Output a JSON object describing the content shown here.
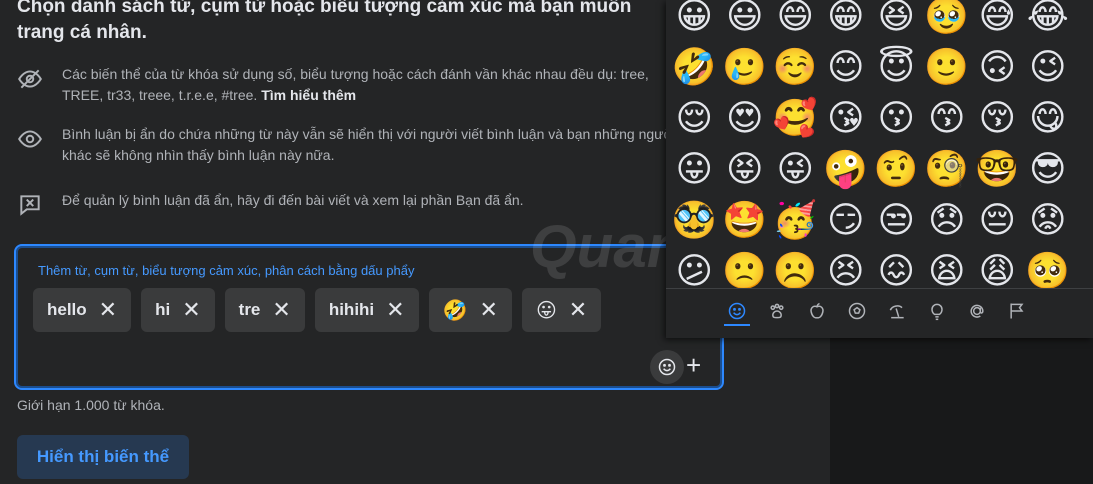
{
  "title": "Chọn danh sách từ, cụm từ hoặc biểu tượng cảm xúc mà bạn muốn trang cá nhân.",
  "info": [
    {
      "icon": "eye-slash-icon",
      "text": "Các biến thể của từ khóa sử dụng số, biểu tượng hoặc cách đánh vần khác nhau đều dụ: tree, TREE, tr33, treee, t.r.e.e, #tree.",
      "link": "Tìm hiểu thêm"
    },
    {
      "icon": "eye-icon",
      "text": "Bình luận bị ẩn do chứa những từ này vẫn sẽ hiển thị với người viết bình luận và bạn những người khác sẽ không nhìn thấy bình luận này nữa."
    },
    {
      "icon": "hidden-comment-icon",
      "text": "Để quản lý bình luận đã ẩn, hãy đi đến bài viết và xem lại phần Bạn đã ẩn."
    }
  ],
  "editor": {
    "placeholder": "Thêm từ, cụm từ, biểu tượng cảm xúc, phân cách bằng dấu phẩy",
    "chips": [
      "hello",
      "hi",
      "tre",
      "hihihi",
      "🤣",
      "😛"
    ],
    "remove_glyph": "✕",
    "plus": "+"
  },
  "limit": "Giới hạn 1.000 từ khóa.",
  "show_button": "Hiển thị biến thể",
  "watermark": "Quantrimang",
  "picker": {
    "emojis": [
      "😀",
      "😃",
      "😄",
      "😁",
      "😆",
      "🥹",
      "😅",
      "😂",
      "🤣",
      "🥲",
      "☺️",
      "😊",
      "😇",
      "🙂",
      "🙃",
      "😉",
      "😌",
      "😍",
      "🥰",
      "😘",
      "😗",
      "😙",
      "😚",
      "😋",
      "😛",
      "😝",
      "😜",
      "🤪",
      "🤨",
      "🧐",
      "🤓",
      "😎",
      "🥸",
      "🤩",
      "🥳",
      "😏",
      "😒",
      "😞",
      "😔",
      "😟",
      "😕",
      "🙁",
      "☹️",
      "😣",
      "😖",
      "😫",
      "😩",
      "🥺"
    ],
    "categories": [
      "smiley-icon",
      "paw-icon",
      "apple-icon",
      "soccer-ball-icon",
      "umbrella-beach-icon",
      "lightbulb-icon",
      "at-symbol-icon",
      "flag-icon"
    ]
  }
}
